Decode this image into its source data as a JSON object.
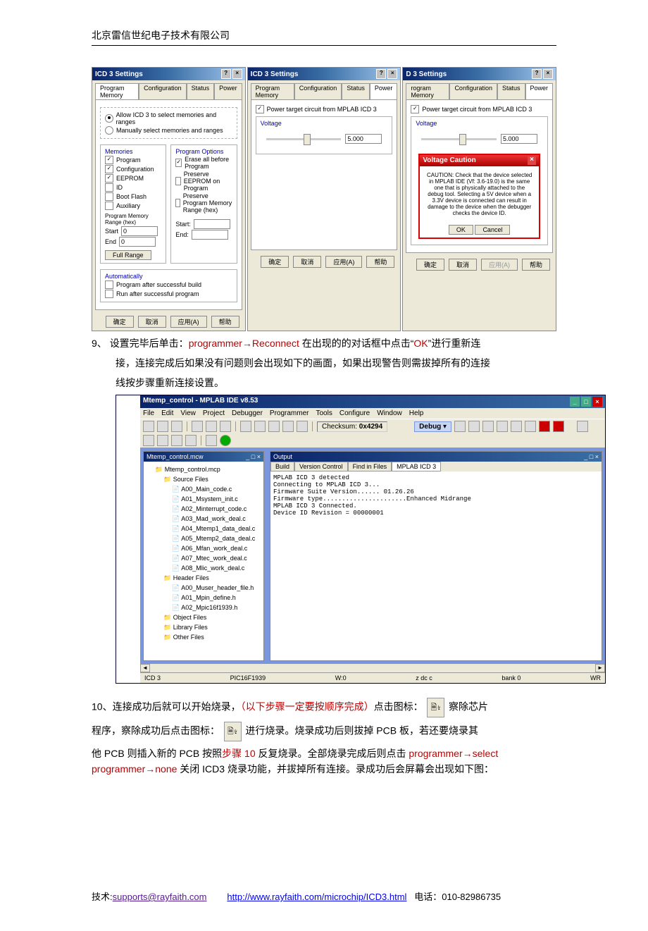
{
  "header": "北京雷信世纪电子技术有限公司",
  "dialog1": {
    "title": "ICD 3 Settings",
    "tabs": [
      "Program Memory",
      "Configuration",
      "Status",
      "Power"
    ],
    "radio1": "Allow ICD 3 to select memories and ranges",
    "radio2": "Manually select memories and ranges",
    "memories_label": "Memories",
    "opts_label": "Program Options",
    "chk_program": "Program",
    "chk_config": "Configuration",
    "chk_eeprom": "EEPROM",
    "chk_id": "ID",
    "chk_bootflash": "Boot Flash",
    "chk_aux": "Auxiliary",
    "chk_erase": "Erase all before Program",
    "chk_preserve_ee": "Preserve EEPROM on Program",
    "chk_preserve_pm": "Preserve Program Memory Range (hex)",
    "pm_range_label": "Program Memory Range (hex)",
    "start_label": "Start",
    "start_val": "0",
    "end_label": "End",
    "end_val": "0",
    "full_range": "Full Range",
    "po_start": "Start:",
    "po_end": "End:",
    "auto_label": "Automatically",
    "auto_chk1": "Program after successful build",
    "auto_chk2": "Run after successful program",
    "btns": [
      "确定",
      "取消",
      "应用(A)",
      "帮助"
    ]
  },
  "dialog2": {
    "title": "ICD 3 Settings",
    "tabs": [
      "Program Memory",
      "Configuration",
      "Status",
      "Power"
    ],
    "chk": "Power target circuit from MPLAB ICD 3",
    "voltage_label": "Voltage",
    "voltage_val": "5.000",
    "btns": [
      "确定",
      "取消",
      "应用(A)",
      "帮助"
    ]
  },
  "dialog3": {
    "title": "D 3 Settings",
    "tabs": [
      "rogram Memory",
      "Configuration",
      "Status",
      "Power"
    ],
    "chk": "Power target circuit from MPLAB ICD 3",
    "voltage_label": "Voltage",
    "voltage_val": "5.000",
    "warn_title": "Voltage Caution",
    "warn_body": "CAUTION: Check that the device selected in MPLAB IDE (Vf: 3.6-19.0) is the same one that is physically attached to the debug tool. Selecting a 5V device when a 3.3V device is connected can result in damage to the device when the debugger checks the device ID.",
    "ok": "OK",
    "cancel": "Cancel",
    "btns": [
      "确定",
      "取消",
      "应用(A)",
      "帮助"
    ]
  },
  "step9_num": "9、",
  "step9_a": "设置完毕后单击：",
  "step9_red1": "programmer→Reconnect",
  "step9_b": " 在出现的的对话框中点击“",
  "step9_red2": "OK",
  "step9_c": "”进行重新连",
  "step9_line2": "接，连接完成后如果没有问题则会出现如下的画面，如果出现警告则需拔掉所有的连接",
  "step9_line3": "线按步骤重新连接设置。",
  "ide": {
    "title": "Mtemp_control - MPLAB IDE v8.53",
    "menus": [
      "File",
      "Edit",
      "View",
      "Project",
      "Debugger",
      "Programmer",
      "Tools",
      "Configure",
      "Window",
      "Help"
    ],
    "checksum_label": "Checksum:",
    "checksum_val": "0x4294",
    "debug_label": "Debug",
    "tree_title": "Mtemp_control.mcw",
    "project": "Mtemp_control.mcp",
    "src_folder": "Source Files",
    "src_files": [
      "A00_Main_code.c",
      "A01_Msystem_init.c",
      "A02_Minterrupt_code.c",
      "A03_Mad_work_deal.c",
      "A04_Mtemp1_data_deal.c",
      "A05_Mtemp2_data_deal.c",
      "A06_Mfan_work_deal.c",
      "A07_Mtec_work_deal.c",
      "A08_Mlic_work_deal.c"
    ],
    "hdr_folder": "Header Files",
    "hdr_files": [
      "A00_Muser_header_file.h",
      "A01_Mpin_define.h",
      "A02_Mpic16f1939.h"
    ],
    "obj_folder": "Object Files",
    "lib_folder": "Library Files",
    "oth_folder": "Other Files",
    "output_title": "Output",
    "out_tabs": [
      "Build",
      "Version Control",
      "Find in Files",
      "MPLAB ICD 3"
    ],
    "out_text": "MPLAB ICD 3 detected\nConnecting to MPLAB ICD 3...\nFirmware Suite Version...... 01.26.26\nFirmware type......................Enhanced Midrange\nMPLAB ICD 3 Connected.\nDevice ID Revision = 00000001",
    "status_left": "ICD 3",
    "status_mid1": "PIC16F1939",
    "status_mid2": "W:0",
    "status_mid3": "z dc c",
    "status_mid4": "bank 0"
  },
  "step10_num": "10、",
  "step10_a": "连接成功后就可以开始烧录，",
  "step10_red1": "（以下步骤一定要按顺序完成）",
  "step10_b": "点击图标：",
  "step10_c": "察除芯片",
  "step10_line2a": "程序，察除成功后点击图标：",
  "step10_line2b": "进行烧录。烧录成功后则拔掉 PCB 板，若还要烧录其",
  "step10_line3a": "他 PCB 则插入新的 PCB 按照",
  "step10_red2": "步骤 10",
  "step10_line3b": " 反复烧录。全部烧录完成后则点击 ",
  "step10_red3": "programmer→select programmer→none",
  "step10_line3c": " 关闭 ICD3 烧录功能，并拔掉所有连接。录成功后会屏幕会出现如下图：",
  "footer_tech": "技术:",
  "footer_email": "supports@rayfaith.com",
  "footer_url": "http://www.rayfaith.com/microchip/ICD3.html",
  "footer_tel_label": "电话：",
  "footer_tel": "010-82986735"
}
